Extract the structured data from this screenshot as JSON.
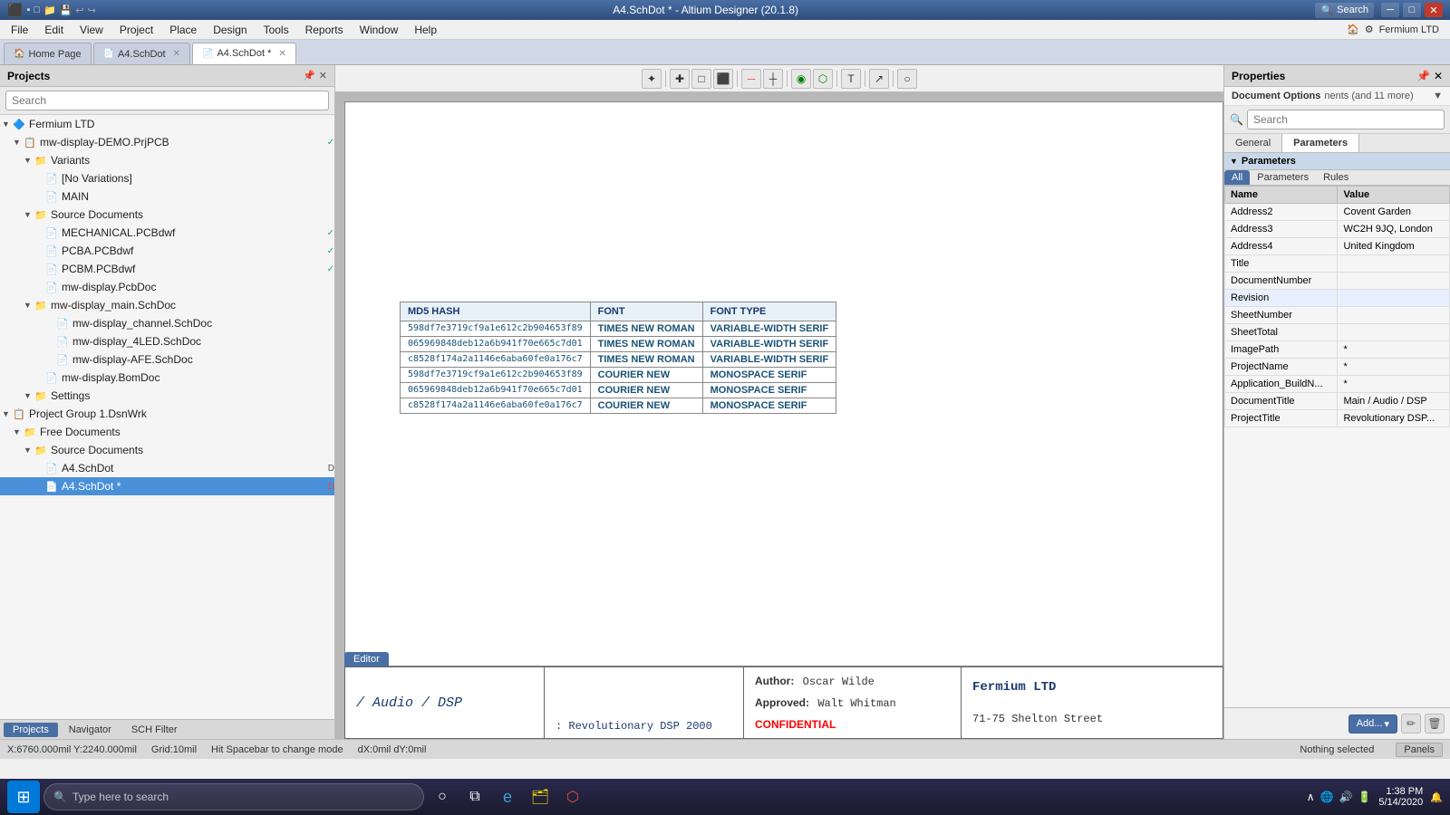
{
  "titlebar": {
    "title": "A4.SchDot * - Altium Designer (20.1.8)",
    "search_label": "Search",
    "min_label": "─",
    "max_label": "□",
    "close_label": "✕"
  },
  "menubar": {
    "items": [
      "File",
      "Edit",
      "View",
      "Project",
      "Place",
      "Design",
      "Tools",
      "Reports",
      "Window",
      "Help"
    ]
  },
  "toolbar": {
    "icons": [
      "⬛",
      "□",
      "◇",
      "↩",
      "↪",
      "⚙",
      "🖹",
      "📁",
      "💾",
      "🔍",
      "✖"
    ]
  },
  "tabs": {
    "items": [
      {
        "label": "Home Page",
        "icon": "🏠",
        "active": false,
        "closeable": false
      },
      {
        "label": "A4.SchDot",
        "icon": "📄",
        "active": false,
        "closeable": true
      },
      {
        "label": "A4.SchDot",
        "icon": "📄",
        "active": true,
        "closeable": true,
        "modified": true
      }
    ]
  },
  "left_panel": {
    "title": "Projects",
    "search_placeholder": "Search",
    "tree": [
      {
        "level": 0,
        "arrow": "▼",
        "icon": "🔷",
        "name": "Fermium LTD",
        "badge": ""
      },
      {
        "level": 1,
        "arrow": "▼",
        "icon": "📋",
        "name": "mw-display-DEMO.PrjPCB",
        "badge": "✓",
        "badge_class": "badge-green"
      },
      {
        "level": 2,
        "arrow": "▼",
        "icon": "📁",
        "name": "Variants",
        "badge": ""
      },
      {
        "level": 3,
        "arrow": " ",
        "icon": "📄",
        "name": "[No Variations]",
        "badge": ""
      },
      {
        "level": 3,
        "arrow": " ",
        "icon": "📄",
        "name": "MAIN",
        "badge": ""
      },
      {
        "level": 2,
        "arrow": "▼",
        "icon": "📁",
        "name": "Source Documents",
        "badge": ""
      },
      {
        "level": 3,
        "arrow": " ",
        "icon": "📄",
        "name": "MECHANICAL.PCBdwf",
        "badge": "✓",
        "badge_class": "badge-green"
      },
      {
        "level": 3,
        "arrow": " ",
        "icon": "📄",
        "name": "PCBA.PCBdwf",
        "badge": "✓",
        "badge_class": "badge-green"
      },
      {
        "level": 3,
        "arrow": " ",
        "icon": "📄",
        "name": "PCBM.PCBdwf",
        "badge": "✓",
        "badge_class": "badge-green"
      },
      {
        "level": 3,
        "arrow": " ",
        "icon": "📄",
        "name": "mw-display.PcbDoc",
        "badge": ""
      },
      {
        "level": 3,
        "arrow": "▼",
        "icon": "📁",
        "name": "mw-display_main.SchDoc",
        "badge": ""
      },
      {
        "level": 4,
        "arrow": " ",
        "icon": "📄",
        "name": "mw-display_channel.SchDoc",
        "badge": ""
      },
      {
        "level": 4,
        "arrow": " ",
        "icon": "📄",
        "name": "mw-display_4LED.SchDoc",
        "badge": ""
      },
      {
        "level": 4,
        "arrow": " ",
        "icon": "📄",
        "name": "mw-display-AFE.SchDoc",
        "badge": ""
      },
      {
        "level": 3,
        "arrow": " ",
        "icon": "📄",
        "name": "mw-display.BomDoc",
        "badge": ""
      },
      {
        "level": 2,
        "arrow": "▼",
        "icon": "📁",
        "name": "Settings",
        "badge": ""
      },
      {
        "level": 0,
        "arrow": "▼",
        "icon": "📋",
        "name": "Project Group 1.DsnWrk",
        "badge": ""
      },
      {
        "level": 1,
        "arrow": "▼",
        "icon": "📁",
        "name": "Free Documents",
        "badge": ""
      },
      {
        "level": 2,
        "arrow": "▼",
        "icon": "📁",
        "name": "Source Documents",
        "badge": ""
      },
      {
        "level": 3,
        "arrow": " ",
        "icon": "📄",
        "name": "A4.SchDot",
        "badge": "D"
      },
      {
        "level": 3,
        "arrow": " ",
        "icon": "📄",
        "name": "A4.SchDot *",
        "badge": "D",
        "selected": true,
        "badge_class": "badge-red"
      }
    ]
  },
  "bottom_tabs": {
    "items": [
      "Projects",
      "Navigator",
      "SCH Filter"
    ]
  },
  "schematic_toolbar": {
    "buttons": [
      "✦",
      "✚",
      "□",
      "⬛",
      "─",
      "┼",
      "◉",
      "⬡",
      "T",
      "↗",
      "○"
    ]
  },
  "hash_table": {
    "headers": [
      "MD5 HASH",
      "FONT",
      "FONT TYPE"
    ],
    "rows": [
      {
        "hash": "598df7e3719cf9a1e612c2b904653f89",
        "font": "TIMES NEW ROMAN",
        "fonttype": "VARIABLE-WIDTH SERIF"
      },
      {
        "hash": "065969848deb12a6b941f70e665c7d01",
        "font": "TIMES NEW ROMAN",
        "fonttype": "VARIABLE-WIDTH SERIF"
      },
      {
        "hash": "c8528f174a2a1146e6aba60fe0a176c7",
        "font": "TIMES NEW ROMAN",
        "fonttype": "VARIABLE-WIDTH SERIF"
      },
      {
        "hash": "598df7e3719cf9a1e612c2b904653f89",
        "font": "COURIER NEW",
        "fonttype": "MONOSPACE SERIF"
      },
      {
        "hash": "065969848deb12a6b941f70e665c7d01",
        "font": "COURIER NEW",
        "fonttype": "MONOSPACE SERIF"
      },
      {
        "hash": "c8528f174a2a1146e6aba60fe0a176c7",
        "font": "COURIER NEW",
        "fonttype": "MONOSPACE SERIF"
      }
    ]
  },
  "title_block": {
    "main_title": "/ Audio / DSP",
    "subtitle": ": Revolutionary DSP 2000",
    "author_label": "Author:",
    "author_value": "Oscar Wilde",
    "approved_label": "Approved:",
    "approved_value": "Walt Whitman",
    "confidential": "CONFIDENTIAL",
    "company": "Fermium LTD",
    "address": "71-75 Shelton Street"
  },
  "right_panel": {
    "title": "Properties",
    "doc_options_label": "Document Options",
    "doc_options_more": "nents (and 11 more)",
    "search_placeholder": "Search",
    "tabs": {
      "general": "General",
      "parameters": "Parameters"
    },
    "params_tabs": {
      "all": "All",
      "parameters": "Parameters",
      "rules": "Rules"
    },
    "section_title": "Parameters",
    "table": {
      "headers": [
        "Name",
        "Value"
      ],
      "rows": [
        {
          "name": "Address2",
          "value": "Covent Garden"
        },
        {
          "name": "Address3",
          "value": "WC2H 9JQ, London"
        },
        {
          "name": "Address4",
          "value": "United Kingdom"
        },
        {
          "name": "Title",
          "value": ""
        },
        {
          "name": "DocumentNumber",
          "value": ""
        },
        {
          "name": "Revision",
          "value": ""
        },
        {
          "name": "SheetNumber",
          "value": ""
        },
        {
          "name": "SheetTotal",
          "value": ""
        },
        {
          "name": "ImagePath",
          "value": "*"
        },
        {
          "name": "ProjectName",
          "value": "*"
        },
        {
          "name": "Application_BuildN...",
          "value": "*"
        },
        {
          "name": "DocumentTitle",
          "value": "Main / Audio / DSP"
        },
        {
          "name": "ProjectTitle",
          "value": "Revolutionary DSP..."
        }
      ]
    },
    "add_button": "Add...",
    "scrollbar_visible": true
  },
  "statusbar": {
    "coords": "X:6760.000mil Y:2240.000mil",
    "grid": "Grid:10mil",
    "hint": "Hit Spacebar to change mode",
    "delta": "dX:0mil dY:0mil",
    "selection": "Nothing selected",
    "panels": "Panels"
  },
  "taskbar": {
    "search_placeholder": "Type here to search",
    "time": "1:38 PM",
    "date": "5/14/2020"
  },
  "editor_tab": "Editor"
}
